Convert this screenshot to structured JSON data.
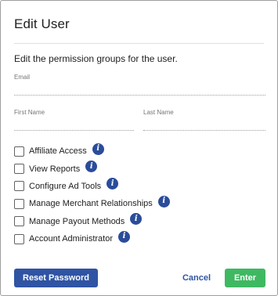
{
  "dialog": {
    "title": "Edit User",
    "description": "Edit the permission groups for the user."
  },
  "fields": {
    "email": {
      "label": "Email",
      "value": ""
    },
    "first_name": {
      "label": "First Name",
      "value": ""
    },
    "last_name": {
      "label": "Last Name",
      "value": ""
    }
  },
  "permissions": [
    {
      "label": "Affiliate Access",
      "checked": false,
      "icon": "info-icon",
      "info_glyph": "i"
    },
    {
      "label": "View Reports",
      "checked": false,
      "icon": "info-icon",
      "info_glyph": "i"
    },
    {
      "label": "Configure Ad Tools",
      "checked": false,
      "icon": "info-icon",
      "info_glyph": "i"
    },
    {
      "label": "Manage Merchant Relationships",
      "checked": false,
      "icon": "info-icon",
      "info_glyph": "i"
    },
    {
      "label": "Manage Payout Methods",
      "checked": false,
      "icon": "info-icon",
      "info_glyph": "i"
    },
    {
      "label": "Account Administrator",
      "checked": false,
      "icon": "info-icon",
      "info_glyph": "i"
    }
  ],
  "buttons": {
    "reset_password": "Reset Password",
    "cancel": "Cancel",
    "enter": "Enter"
  },
  "colors": {
    "primary": "#2f54a3",
    "success": "#3fb862",
    "info_icon": "#2a4c9a"
  }
}
